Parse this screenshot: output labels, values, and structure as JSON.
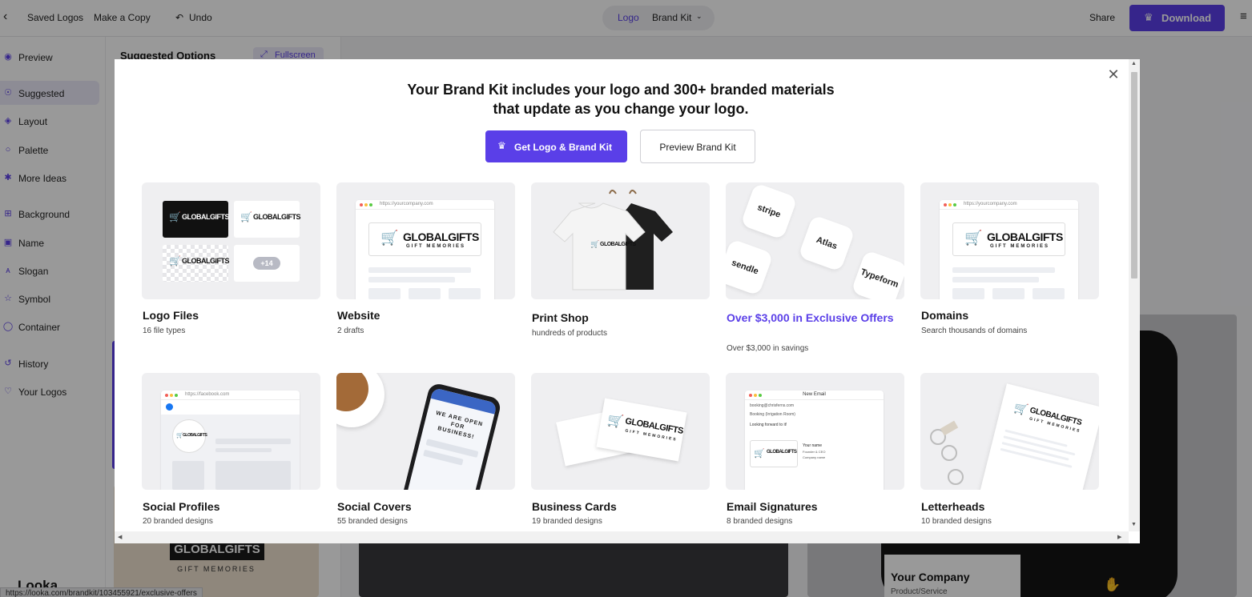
{
  "topbar": {
    "back_icon": "chevron-left-icon",
    "saved_logos": "Saved Logos",
    "make_copy": "Make a Copy",
    "undo": "Undo",
    "tab_logo": "Logo",
    "tab_brand_kit": "Brand Kit",
    "share": "Share",
    "download": "Download"
  },
  "sidebar": {
    "items": [
      {
        "label": "Preview",
        "icon": "eye-icon"
      },
      {
        "label": "Suggested",
        "icon": "lightbulb-icon"
      },
      {
        "label": "Layout",
        "icon": "layers-icon"
      },
      {
        "label": "Palette",
        "icon": "droplet-icon"
      },
      {
        "label": "More Ideas",
        "icon": "magic-wand-icon"
      },
      {
        "label": "Background",
        "icon": "grid-icon"
      },
      {
        "label": "Name",
        "icon": "text-box-icon"
      },
      {
        "label": "Slogan",
        "icon": "text-style-icon"
      },
      {
        "label": "Symbol",
        "icon": "star-icon"
      },
      {
        "label": "Container",
        "icon": "circle-icon"
      },
      {
        "label": "History",
        "icon": "history-icon"
      },
      {
        "label": "Your Logos",
        "icon": "heart-icon"
      }
    ]
  },
  "options_panel": {
    "title": "Suggested Options",
    "fullscreen": "Fullscreen",
    "preview_text_1": "GLOBALGIFTS",
    "preview_text_2": "GIFT MEMORIES"
  },
  "background_preview": {
    "company": "Your Company",
    "subtitle": "Product/Service"
  },
  "footer": {
    "brand": "Looka",
    "status_url": "https://looka.com/brandkit/103455921/exclusive-offers"
  },
  "modal": {
    "headline_line1": "Your Brand Kit includes your logo and 300+ branded materials",
    "headline_line2": "that update as you change your logo.",
    "primary_button": "Get Logo & Brand Kit",
    "secondary_button": "Preview Brand Kit",
    "tiles": [
      {
        "title": "Logo Files",
        "subtitle": "16 file types"
      },
      {
        "title": "Website",
        "subtitle": "2 drafts"
      },
      {
        "title": "Print Shop",
        "subtitle": "hundreds of products"
      },
      {
        "title": "Over $3,000 in Exclusive Offers",
        "subtitle": "Over $3,000 in savings"
      },
      {
        "title": "Domains",
        "subtitle": "Search thousands of domains"
      },
      {
        "title": "Social Profiles",
        "subtitle": "20 branded designs"
      },
      {
        "title": "Social Covers",
        "subtitle": "55 branded designs"
      },
      {
        "title": "Business Cards",
        "subtitle": "19 branded designs"
      },
      {
        "title": "Email Signatures",
        "subtitle": "8 branded designs"
      },
      {
        "title": "Letterheads",
        "subtitle": "10 branded designs"
      }
    ],
    "thumb": {
      "brand_name": "GLOBALGIFTS",
      "brand_tagline": "GIFT MEMORIES",
      "more_count": "+14",
      "url_company": "https://yourcompany.com",
      "url_facebook": "https://facebook.com",
      "partners": [
        "stripe",
        "Atlas",
        "sendle",
        "Typeform"
      ],
      "phone_text": "WE ARE OPEN FOR BUSINESS!",
      "email_title": "New Email",
      "email_to": "booking@chrisferns.com",
      "email_subject": "Booking (Irrigation Room)",
      "email_body": "Looking forward to it!",
      "email_name": "Your name",
      "email_role": "Founder & CEO",
      "email_company": "Company name"
    }
  },
  "colors": {
    "accent": "#5a3fe8",
    "cart_red": "#b8202a"
  }
}
